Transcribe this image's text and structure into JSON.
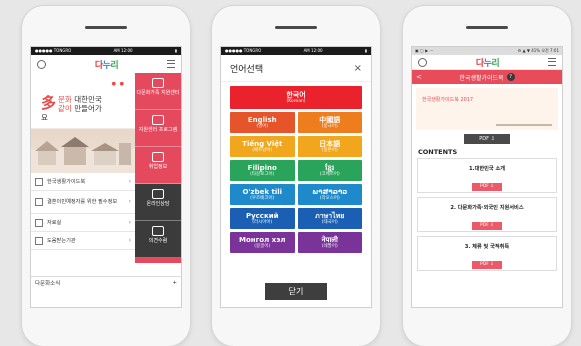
{
  "phone1": {
    "status": {
      "carrier": "●●●●● TONGRO",
      "time": "AM 12:00"
    },
    "logo": [
      "다",
      "누",
      "리"
    ],
    "hero": {
      "big": "多",
      "line1_hl": "문화",
      "line1": " 대한민국",
      "line2_hl": "같이",
      "line2": " 만들어가요",
      "dots": "● ●"
    },
    "side_menu": [
      "다문화가족 지원센터",
      "지원센터 프로그램",
      "취업정보",
      "온라인상담",
      "의견수렴"
    ],
    "list": [
      "한국생활가이드북",
      "결혼이민예정자를 위한 필수정보",
      "자료실",
      "도움받는기관"
    ],
    "news": {
      "label": "다문화소식",
      "plus": "+"
    }
  },
  "phone2": {
    "status": {
      "carrier": "●●●●● TONGRO",
      "time": "AM 12:00"
    },
    "title": "언어선택",
    "close": "×",
    "korean": {
      "name": "한국어",
      "sub": "(Korean)"
    },
    "languages": [
      {
        "name": "English",
        "sub": "(영어)",
        "color": "#e5542b"
      },
      {
        "name": "中國語",
        "sub": "(중국어)",
        "color": "#ee7d1e"
      },
      {
        "name": "Tiếng Việt",
        "sub": "(베트남어)",
        "color": "#f2a61d"
      },
      {
        "name": "日本語",
        "sub": "(일본어)",
        "color": "#f2a61d"
      },
      {
        "name": "Filipino",
        "sub": "(타갈로그어)",
        "color": "#2aa35b"
      },
      {
        "name": "ខ្មែរ",
        "sub": "(크메르어)",
        "color": "#2aa35b"
      },
      {
        "name": "O'zbek tili",
        "sub": "(우즈베크어)",
        "color": "#1f8acb"
      },
      {
        "name": "ພາສາລາວ",
        "sub": "(라오스어)",
        "color": "#1f8acb"
      },
      {
        "name": "Русский",
        "sub": "(러시아어)",
        "color": "#1a5fb4"
      },
      {
        "name": "ภาษาไทย",
        "sub": "(태국어)",
        "color": "#1a5fb4"
      },
      {
        "name": "Монгол хэл",
        "sub": "(몽골어)",
        "color": "#7a3499"
      },
      {
        "name": "नेपाली",
        "sub": "(네팔어)",
        "color": "#7a3499"
      }
    ],
    "close_button": "닫기"
  },
  "phone3": {
    "status": {
      "left": "▣ ▢ ▶ ···",
      "right": "⚙ ▲ ▼ 41% 오전 7:01"
    },
    "logo": [
      "다",
      "누",
      "리"
    ],
    "title": "한국생활가이드북",
    "help": "?",
    "back": "<",
    "banner_title": "한국생활가이드북 2017",
    "pdf_label": "PDF ⇩",
    "contents_heading": "CONTENTS",
    "chapters": [
      "1.대한민국 소개",
      "2. 다문화가족·외국인 지원서비스",
      "3. 체류 및 국적취득"
    ]
  }
}
